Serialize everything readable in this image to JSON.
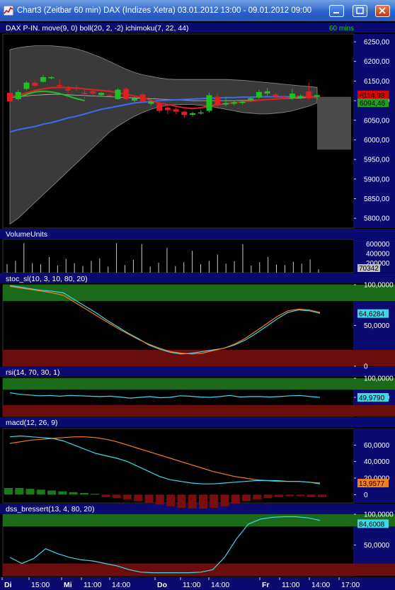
{
  "window": {
    "title": "Chart3 (Zeitbar 60 min)  DAX (Indizes Xetra) 03.01.2012 13:00 - 09.01.2012 09:00",
    "buttons": [
      "minimize",
      "maximize",
      "close"
    ]
  },
  "chart_data": [
    {
      "panel": "price",
      "type": "candlestick",
      "header": "DAX P-IN. move(9, 0) boll(20, 2, -2) ichimoku(7, 22, 44)",
      "timeframe": "60 mins",
      "yticks": [
        "6250,00",
        "6200,00",
        "6150,00",
        "6100,00",
        "6050,00",
        "6000,00",
        "5950,00",
        "5900,00",
        "5850,00",
        "5800,00"
      ],
      "ylim": [
        5775,
        6270
      ],
      "price_badges": [
        {
          "value": "6114,93",
          "color": "#e00000"
        },
        {
          "value": "6094,46",
          "color": "#20a020"
        }
      ],
      "candles": [
        {
          "o": 6120,
          "c": 6098,
          "h": 6124,
          "l": 6094
        },
        {
          "o": 6104,
          "c": 6122,
          "h": 6128,
          "l": 6100
        },
        {
          "o": 6130,
          "c": 6146,
          "h": 6150,
          "l": 6126
        },
        {
          "o": 6146,
          "c": 6138,
          "h": 6150,
          "l": 6134
        },
        {
          "o": 6148,
          "c": 6160,
          "h": 6166,
          "l": 6146
        },
        {
          "o": 6158,
          "c": 6160,
          "h": 6162,
          "l": 6154
        },
        {
          "o": 6140,
          "c": 6138,
          "h": 6154,
          "l": 6132
        },
        {
          "o": 6130,
          "c": 6126,
          "h": 6138,
          "l": 6120
        },
        {
          "o": 6134,
          "c": 6130,
          "h": 6140,
          "l": 6124
        },
        {
          "o": 6120,
          "c": 6118,
          "h": 6128,
          "l": 6104
        },
        {
          "o": 6124,
          "c": 6118,
          "h": 6130,
          "l": 6114
        },
        {
          "o": 6114,
          "c": 6120,
          "h": 6122,
          "l": 6110
        },
        {
          "o": 6114,
          "c": 6113,
          "h": 6116,
          "l": 6110
        },
        {
          "o": 6104,
          "c": 6128,
          "h": 6132,
          "l": 6102
        },
        {
          "o": 6130,
          "c": 6104,
          "h": 6134,
          "l": 6100
        },
        {
          "o": 6100,
          "c": 6106,
          "h": 6110,
          "l": 6096
        },
        {
          "o": 6116,
          "c": 6098,
          "h": 6120,
          "l": 6094
        },
        {
          "o": 6092,
          "c": 6098,
          "h": 6102,
          "l": 6088
        },
        {
          "o": 6094,
          "c": 6074,
          "h": 6098,
          "l": 6070
        },
        {
          "o": 6082,
          "c": 6076,
          "h": 6086,
          "l": 6066
        },
        {
          "o": 6078,
          "c": 6072,
          "h": 6082,
          "l": 6066
        },
        {
          "o": 6072,
          "c": 6064,
          "h": 6074,
          "l": 6056
        },
        {
          "o": 6064,
          "c": 6068,
          "h": 6072,
          "l": 6060
        },
        {
          "o": 6070,
          "c": 6070,
          "h": 6076,
          "l": 6064
        },
        {
          "o": 6074,
          "c": 6114,
          "h": 6120,
          "l": 6070
        },
        {
          "o": 6110,
          "c": 6088,
          "h": 6118,
          "l": 6080
        },
        {
          "o": 6090,
          "c": 6094,
          "h": 6110,
          "l": 6086
        },
        {
          "o": 6092,
          "c": 6096,
          "h": 6100,
          "l": 6088
        },
        {
          "o": 6094,
          "c": 6098,
          "h": 6102,
          "l": 6090
        },
        {
          "o": 6100,
          "c": 6106,
          "h": 6110,
          "l": 6098
        },
        {
          "o": 6108,
          "c": 6122,
          "h": 6128,
          "l": 6104
        },
        {
          "o": 6118,
          "c": 6124,
          "h": 6132,
          "l": 6110
        },
        {
          "o": 6116,
          "c": 6110,
          "h": 6120,
          "l": 6104
        },
        {
          "o": 6110,
          "c": 6108,
          "h": 6114,
          "l": 6104
        },
        {
          "o": 6106,
          "c": 6118,
          "h": 6130,
          "l": 6102
        },
        {
          "o": 6108,
          "c": 6112,
          "h": 6116,
          "l": 6104
        },
        {
          "o": 6124,
          "c": 6106,
          "h": 6146,
          "l": 6102
        },
        {
          "o": 6110,
          "c": 6114,
          "h": 6118,
          "l": 6102
        }
      ],
      "move": [
        6110,
        6114,
        6120,
        6126,
        6130,
        6133,
        6134,
        6133,
        6132,
        6130,
        6128,
        6126,
        6124,
        6120,
        6116,
        6112,
        6108,
        6100,
        6094,
        6090,
        6086,
        6082,
        6080,
        6082,
        6086,
        6090,
        6092,
        6095,
        6097,
        6099,
        6101,
        6103,
        6104,
        6106,
        6108,
        6110,
        6110,
        6108
      ],
      "boll_mid": [
        6108,
        6110,
        6112,
        6114,
        6115,
        6116,
        6116,
        6115,
        6114,
        6113,
        6112,
        6111,
        6110,
        6109,
        6108,
        6107,
        6106,
        6105,
        6104,
        6103,
        6102,
        6101,
        6100,
        6100,
        6100,
        6100,
        6100,
        6100,
        6101,
        6101,
        6102,
        6103,
        6104,
        6105,
        6106,
        6107,
        6108,
        6108
      ],
      "ichimoku_blue": [
        6020,
        6026,
        6030,
        6034,
        6040,
        6044,
        6050,
        6056,
        6060,
        6066,
        6072,
        6078,
        6082,
        6086,
        6090,
        6094,
        6096,
        6098,
        6100,
        6101,
        6102,
        6103,
        6104,
        6105,
        6106,
        6107,
        6108,
        6108,
        6109,
        6109,
        6110,
        6110,
        6110,
        6110,
        6110,
        6110,
        6110,
        6110
      ],
      "ichimoku_green": [
        6108,
        6116,
        6122,
        6124,
        6122,
        6118,
        6112,
        6105,
        6100
      ],
      "cloud_upper": [
        6230,
        6235,
        6238,
        6240,
        6240,
        6240,
        6238,
        6236,
        6232,
        6226,
        6218,
        6210,
        6200,
        6190,
        6180,
        6172,
        6166,
        6162,
        6158,
        6155,
        6154,
        6154,
        6154,
        6154,
        6154,
        6154,
        6154,
        6153,
        6152,
        6150,
        6148,
        6146,
        6144,
        6142,
        6140,
        6138,
        6136,
        6134
      ],
      "cloud_lower": [
        5785,
        5800,
        5820,
        5840,
        5860,
        5880,
        5900,
        5920,
        5940,
        5960,
        5980,
        6000,
        6020,
        6035,
        6048,
        6060,
        6070,
        6078,
        6084,
        6088,
        6090,
        6090,
        6090,
        6088,
        6086,
        6082,
        6078,
        6074,
        6070,
        6068,
        6066,
        6066,
        6068,
        6070,
        6074,
        6080,
        6086,
        6094
      ]
    },
    {
      "panel": "volume",
      "type": "bar",
      "header": "VolumeUnits",
      "yticks": [
        "600000",
        "400000",
        "200000"
      ],
      "ylim": [
        0,
        700000
      ],
      "last_value": "70342",
      "values": [
        180000,
        250000,
        620000,
        200000,
        180000,
        330000,
        150000,
        290000,
        200000,
        140000,
        250000,
        300000,
        130000,
        620000,
        160000,
        270000,
        600000,
        130000,
        210000,
        520000,
        140000,
        220000,
        460000,
        180000,
        250000,
        380000,
        190000,
        240000,
        600000,
        150000,
        220000,
        330000,
        170000,
        160000,
        230000,
        190000,
        280000,
        70342
      ]
    },
    {
      "panel": "stochastic",
      "type": "line",
      "header": "stoc_sl(10, 3, 10, 80, 20)",
      "yticks": [
        "100,0000",
        "50,0000",
        "0"
      ],
      "ylim": [
        0,
        100
      ],
      "zones": {
        "upper": 80,
        "lower": 20
      },
      "last_value": "64,6284",
      "series": [
        {
          "color": "#40d8e8",
          "values": [
            99,
            97,
            95,
            93,
            92,
            90,
            82,
            74,
            66,
            57,
            49,
            41,
            34,
            26,
            21,
            17,
            15,
            16,
            18,
            20,
            22,
            26,
            32,
            40,
            49,
            58,
            66,
            69,
            68,
            65
          ]
        },
        {
          "color": "#f08020",
          "values": [
            98,
            96,
            94,
            92,
            90,
            87,
            79,
            71,
            63,
            55,
            47,
            40,
            33,
            27,
            22,
            18,
            16,
            15,
            16,
            19,
            22,
            27,
            34,
            43,
            52,
            61,
            68,
            70,
            69,
            66
          ]
        }
      ]
    },
    {
      "panel": "rsi",
      "type": "line",
      "header": "rsi(14, 70, 30, 1)",
      "yticks": [
        "100,0000",
        "50,0000"
      ],
      "ylim": [
        0,
        100
      ],
      "zones": {
        "upper": 70,
        "lower": 30
      },
      "last_value": "49,9790",
      "series": [
        {
          "color": "#40d8e8",
          "values": [
            62,
            58,
            56,
            54,
            55,
            53,
            55,
            54,
            53,
            52,
            53,
            51,
            48,
            50,
            52,
            49,
            50,
            54,
            53,
            51,
            50,
            52,
            55,
            51,
            52,
            52,
            51,
            52,
            54,
            55,
            52,
            50
          ]
        }
      ]
    },
    {
      "panel": "macd",
      "type": "line",
      "header": "macd(12, 26, 9)",
      "yticks": [
        "60,0000",
        "40,0000",
        "20,0000",
        "0"
      ],
      "ylim": [
        -10,
        80
      ],
      "last_value": "13,9577",
      "series": [
        {
          "color": "#f08020",
          "values": [
            62,
            64,
            66,
            67,
            68,
            69,
            70,
            70,
            69,
            67,
            64,
            60,
            56,
            52,
            48,
            44,
            40,
            36,
            32,
            28,
            25,
            22,
            20,
            18,
            17,
            16,
            16,
            16,
            15,
            14
          ]
        },
        {
          "color": "#40d8e8",
          "values": [
            70,
            71,
            70,
            69,
            68,
            65,
            60,
            55,
            50,
            47,
            44,
            40,
            34,
            28,
            22,
            18,
            16,
            14,
            13,
            13,
            14,
            15,
            16,
            17,
            17,
            17,
            16,
            16,
            15,
            13
          ]
        }
      ],
      "histogram": [
        8,
        8,
        7,
        6,
        5,
        4,
        3,
        2,
        1,
        -3,
        -4,
        -6,
        -8,
        -10,
        -12,
        -14,
        -16,
        -17,
        -17,
        -16,
        -14,
        -11,
        -8,
        -6,
        -4,
        -3,
        -2,
        -2,
        -3,
        -3
      ]
    },
    {
      "panel": "dss",
      "type": "line",
      "header": "dss_bressert(13, 4, 80, 20)",
      "yticks": [
        "100,0000",
        "50,0000"
      ],
      "ylim": [
        0,
        100
      ],
      "zones": {
        "upper": 80,
        "lower": 20
      },
      "last_value": "84,6008",
      "series": [
        {
          "color": "#40d8e8",
          "values": [
            30,
            20,
            28,
            44,
            36,
            30,
            26,
            24,
            20,
            16,
            10,
            6,
            5,
            5,
            5,
            5,
            6,
            10,
            30,
            60,
            84,
            92,
            95,
            96,
            96,
            94,
            90
          ]
        }
      ]
    },
    {
      "panel": "xaxis",
      "ticks": [
        {
          "label": "Di",
          "bold": true
        },
        {
          "label": "15:00",
          "bold": false
        },
        {
          "label": "Mi",
          "bold": true
        },
        {
          "label": "11:00",
          "bold": false
        },
        {
          "label": "14:00",
          "bold": false
        },
        {
          "label": "Do",
          "bold": true
        },
        {
          "label": "11:00",
          "bold": false
        },
        {
          "label": "14:00",
          "bold": false
        },
        {
          "label": "Fr",
          "bold": true
        },
        {
          "label": "11:00",
          "bold": false
        },
        {
          "label": "14:00",
          "bold": false
        },
        {
          "label": "17:00",
          "bold": false
        }
      ]
    }
  ]
}
